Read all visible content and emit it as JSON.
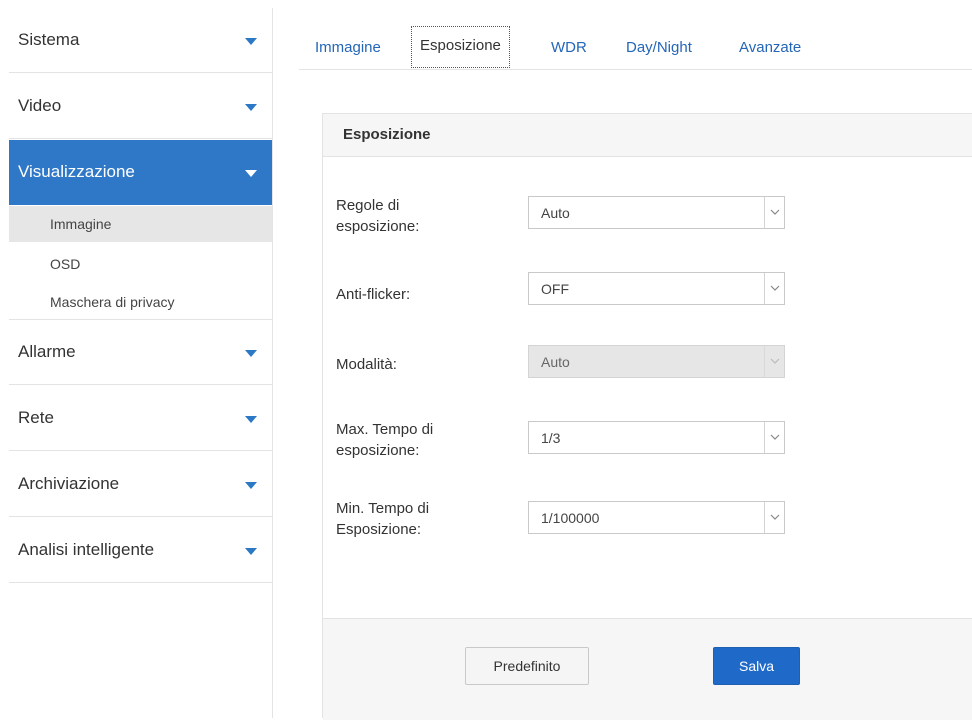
{
  "sidebar": {
    "items": [
      {
        "label": "Sistema"
      },
      {
        "label": "Video"
      },
      {
        "label": "Visualizzazione"
      },
      {
        "label": "Allarme"
      },
      {
        "label": "Rete"
      },
      {
        "label": "Archiviazione"
      },
      {
        "label": "Analisi intelligente"
      }
    ],
    "sub_items": [
      {
        "label": "Immagine"
      },
      {
        "label": "OSD"
      },
      {
        "label": "Maschera di privacy"
      }
    ]
  },
  "tabs": [
    {
      "label": "Immagine"
    },
    {
      "label": "Esposizione"
    },
    {
      "label": "WDR"
    },
    {
      "label": "Day/Night"
    },
    {
      "label": "Avanzate"
    }
  ],
  "panel": {
    "title": "Esposizione",
    "fields": [
      {
        "label": "Regole di esposizione:",
        "value": "Auto"
      },
      {
        "label": "Anti-flicker:",
        "value": "OFF"
      },
      {
        "label": "Modalità:",
        "value": "Auto"
      },
      {
        "label": "Max. Tempo di esposizione:",
        "value": "1/3"
      },
      {
        "label": "Min. Tempo di Esposizione:",
        "value": "1/100000"
      }
    ]
  },
  "buttons": {
    "default_label": "Predefinito",
    "save_label": "Salva"
  },
  "colors": {
    "accent": "#2f78c7",
    "link": "#2466b8",
    "save_button": "#1f69c9"
  }
}
